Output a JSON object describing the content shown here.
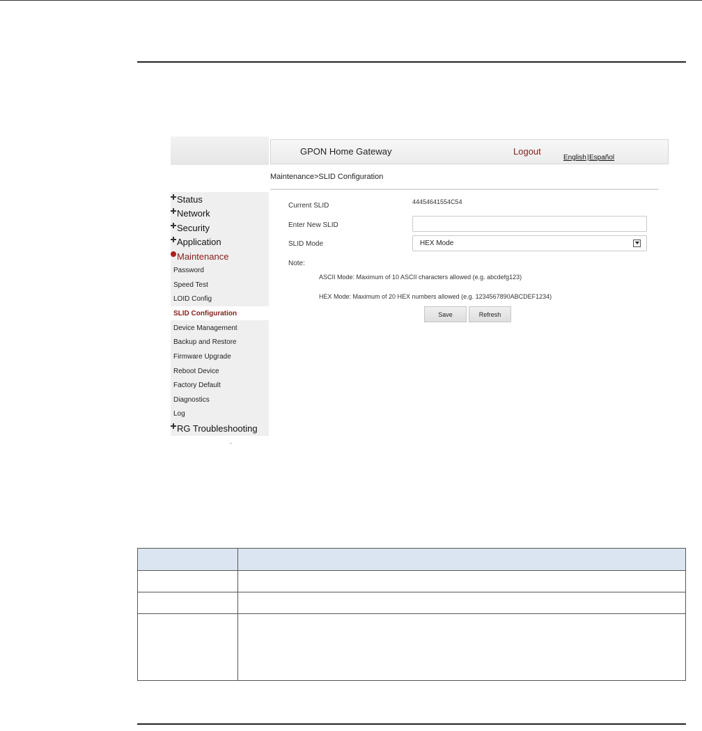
{
  "app": {
    "title": "GPON Home Gateway",
    "logout": "Logout",
    "lang_english": "English",
    "lang_sep": "|",
    "lang_espanol": "Español"
  },
  "breadcrumb": "Maintenance>SLID Configuration",
  "sidebar": {
    "items": [
      {
        "label": "Status",
        "type": "group",
        "icon": "plus-icon"
      },
      {
        "label": "Network",
        "type": "group",
        "icon": "plus-icon"
      },
      {
        "label": "Security",
        "type": "group",
        "icon": "plus-icon"
      },
      {
        "label": "Application",
        "type": "group",
        "icon": "plus-icon"
      },
      {
        "label": "Maintenance",
        "type": "group",
        "icon": "minus-icon",
        "expanded": true
      },
      {
        "label": "Password",
        "type": "sub"
      },
      {
        "label": "Speed Test",
        "type": "sub"
      },
      {
        "label": "LOID Config",
        "type": "sub"
      },
      {
        "label": "SLID Configuration",
        "type": "sub",
        "active": true
      },
      {
        "label": "Device Management",
        "type": "sub"
      },
      {
        "label": "Backup and Restore",
        "type": "sub"
      },
      {
        "label": "Firmware Upgrade",
        "type": "sub"
      },
      {
        "label": "Reboot Device",
        "type": "sub"
      },
      {
        "label": "Factory Default",
        "type": "sub"
      },
      {
        "label": "Diagnostics",
        "type": "sub"
      },
      {
        "label": "Log",
        "type": "sub"
      },
      {
        "label": "RG Troubleshooting",
        "type": "group",
        "icon": "plus-icon"
      }
    ]
  },
  "form": {
    "current_slid_label": "Current SLID",
    "current_slid_value": "44454641554C54",
    "new_slid_label": "Enter New SLID",
    "new_slid_value": "",
    "slid_mode_label": "SLID Mode",
    "slid_mode_value": "HEX Mode",
    "note_label": "Note:",
    "note_ascii": "ASCII Mode: Maximum of 10 ASCII characters allowed (e.g. abcdefg123)",
    "note_hex": "HEX Mode: Maximum of 20 HEX numbers allowed (e.g. 1234567890ABCDEF1234)",
    "save": "Save",
    "refresh": "Refresh"
  },
  "colors": {
    "accent": "#8b1b1b",
    "table_header": "#dbe5f1"
  }
}
